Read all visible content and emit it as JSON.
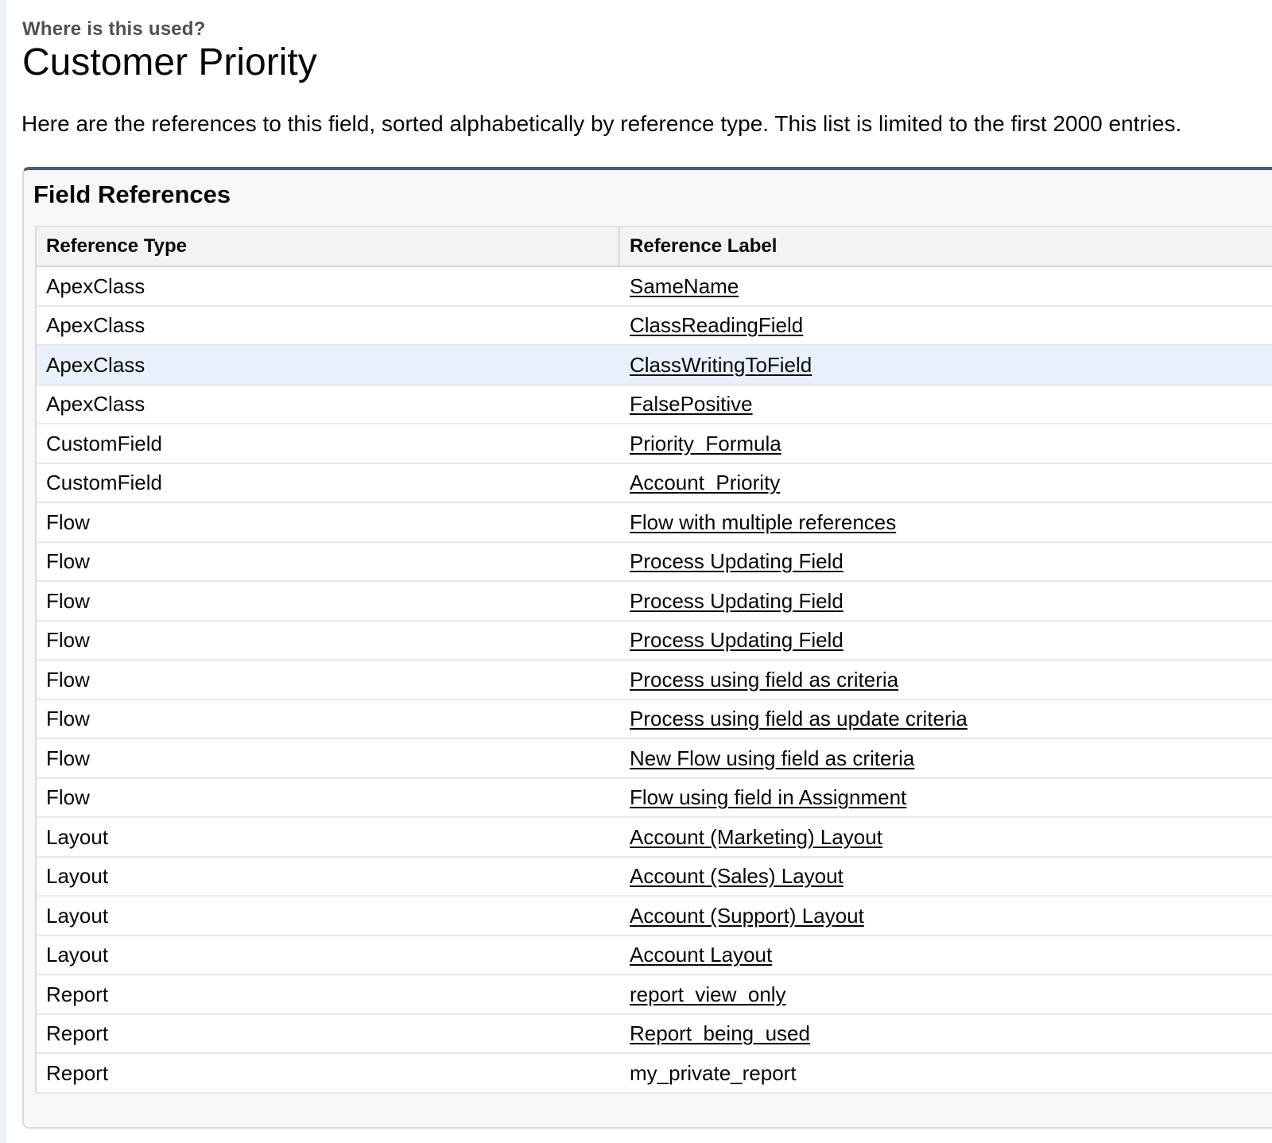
{
  "header": {
    "eyebrow": "Where is this used?",
    "title": "Customer Priority",
    "description": "Here are the references to this field, sorted alphabetically by reference type. This list is limited to the first 2000 entries."
  },
  "card": {
    "title": "Field References",
    "columns": {
      "type": "Reference Type",
      "label": "Reference Label"
    },
    "rows": [
      {
        "type": "ApexClass",
        "label": "SameName",
        "link": true
      },
      {
        "type": "ApexClass",
        "label": "ClassReadingField",
        "link": true
      },
      {
        "type": "ApexClass",
        "label": "ClassWritingToField",
        "link": true,
        "highlighted": true
      },
      {
        "type": "ApexClass",
        "label": "FalsePositive",
        "link": true
      },
      {
        "type": "CustomField",
        "label": "Priority_Formula",
        "link": true
      },
      {
        "type": "CustomField",
        "label": "Account_Priority",
        "link": true
      },
      {
        "type": "Flow",
        "label": "Flow with multiple references",
        "link": true
      },
      {
        "type": "Flow",
        "label": "Process Updating Field",
        "link": true
      },
      {
        "type": "Flow",
        "label": "Process Updating Field",
        "link": true
      },
      {
        "type": "Flow",
        "label": "Process Updating Field",
        "link": true
      },
      {
        "type": "Flow",
        "label": "Process using field as criteria",
        "link": true
      },
      {
        "type": "Flow",
        "label": "Process using field as update criteria",
        "link": true
      },
      {
        "type": "Flow",
        "label": "New Flow using field as criteria",
        "link": true
      },
      {
        "type": "Flow",
        "label": "Flow using field in Assignment",
        "link": true
      },
      {
        "type": "Layout",
        "label": "Account (Marketing) Layout",
        "link": true
      },
      {
        "type": "Layout",
        "label": "Account (Sales) Layout",
        "link": true
      },
      {
        "type": "Layout",
        "label": "Account (Support) Layout",
        "link": true
      },
      {
        "type": "Layout",
        "label": "Account Layout",
        "link": true
      },
      {
        "type": "Report",
        "label": "report_view_only",
        "link": true
      },
      {
        "type": "Report",
        "label": "Report_being_used",
        "link": true
      },
      {
        "type": "Report",
        "label": "my_private_report",
        "link": false
      }
    ]
  }
}
